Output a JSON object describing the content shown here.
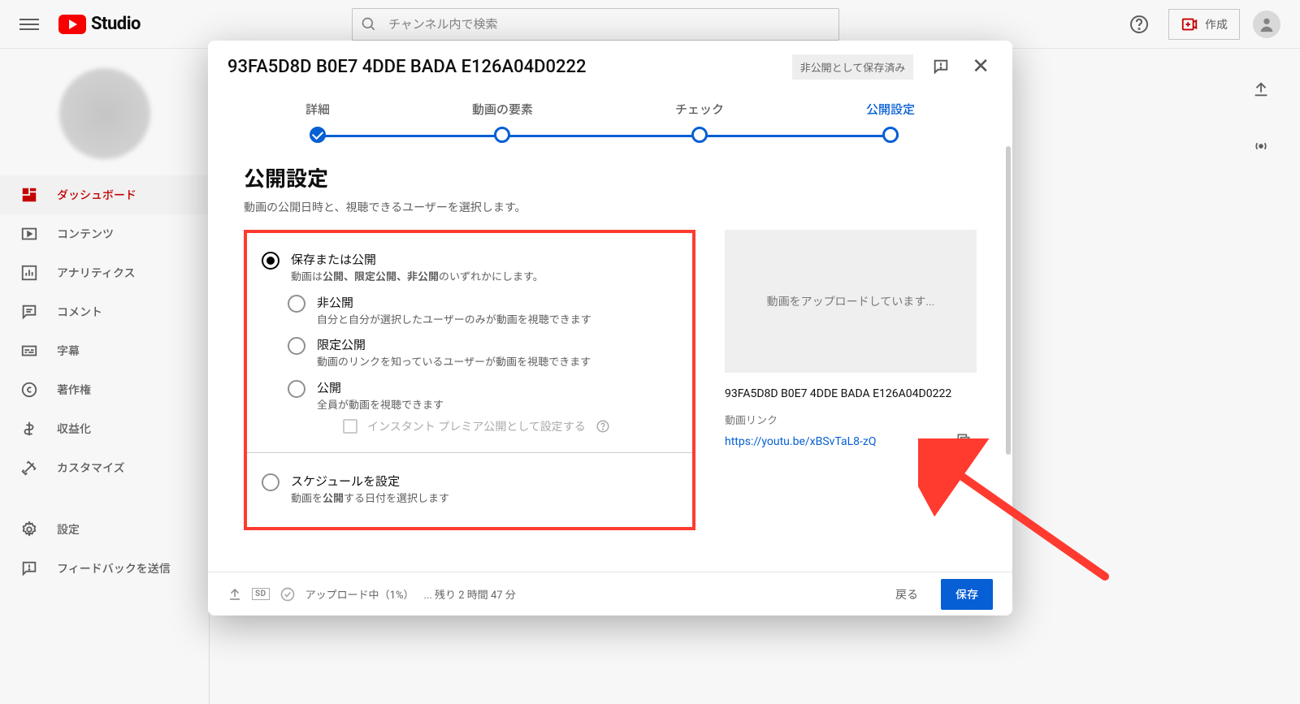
{
  "header": {
    "logo_text": "Studio",
    "search_placeholder": "チャンネル内で検索",
    "create_label": "作成"
  },
  "sidebar": {
    "items": [
      {
        "label": "ダッシュボード"
      },
      {
        "label": "コンテンツ"
      },
      {
        "label": "アナリティクス"
      },
      {
        "label": "コメント"
      },
      {
        "label": "字幕"
      },
      {
        "label": "著作権"
      },
      {
        "label": "収益化"
      },
      {
        "label": "カスタマイズ"
      },
      {
        "label": "設定"
      },
      {
        "label": "フィードバックを送信"
      }
    ]
  },
  "modal": {
    "title": "93FA5D8D B0E7 4DDE BADA E126A04D0222",
    "save_status": "非公開として保存済み",
    "steps": {
      "detail": "詳細",
      "elements": "動画の要素",
      "checks": "チェック",
      "visibility": "公開設定"
    },
    "section_title": "公開設定",
    "section_sub": "動画の公開日時と、視聴できるユーザーを選択します。",
    "save_publish": {
      "label": "保存または公開",
      "desc_pre": "動画は",
      "desc_bold": "公開、限定公開、非公開",
      "desc_post": "のいずれかにします。"
    },
    "private": {
      "label": "非公開",
      "desc": "自分と自分が選択したユーザーのみが動画を視聴できます"
    },
    "unlisted": {
      "label": "限定公開",
      "desc": "動画のリンクを知っているユーザーが動画を視聴できます"
    },
    "public": {
      "label": "公開",
      "desc": "全員が動画を視聴できます",
      "premiere": "インスタント プレミア公開として設定する"
    },
    "schedule": {
      "label": "スケジュールを設定",
      "desc_pre": "動画を",
      "desc_bold": "公開",
      "desc_post": "する日付を選択します"
    },
    "preview": {
      "uploading": "動画をアップロードしています...",
      "title": "93FA5D8D B0E7 4DDE BADA E126A04D0222",
      "link_label": "動画リンク",
      "link": "https://youtu.be/xBSvTaL8-zQ"
    },
    "footer": {
      "progress_text": "アップロード中（1%）",
      "time_remaining": "... 残り 2 時間 47 分",
      "back": "戻る",
      "save": "保存"
    }
  }
}
